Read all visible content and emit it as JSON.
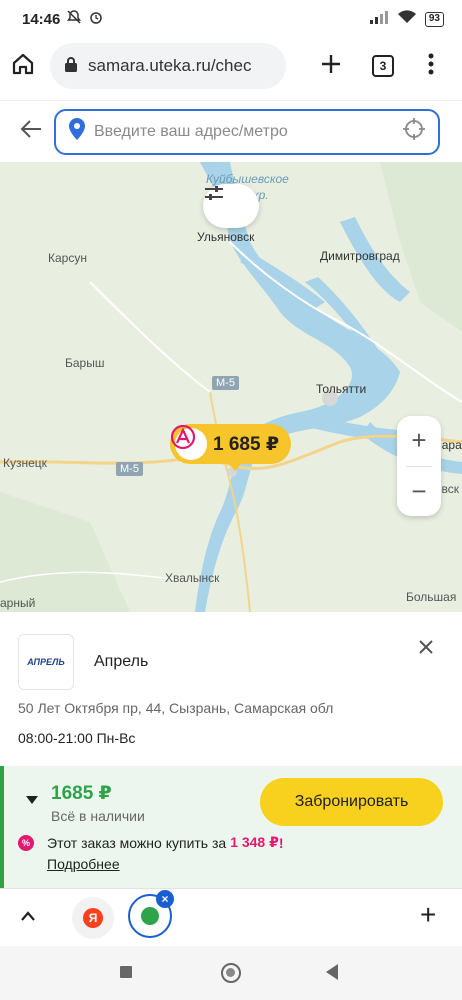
{
  "status_bar": {
    "time": "14:46",
    "battery": "93"
  },
  "browser": {
    "url": "samara.uteka.ru/chec",
    "tab_count": "3"
  },
  "search": {
    "placeholder": "Введите ваш адрес/метро"
  },
  "map": {
    "labels": {
      "reservoir": "Куйбышевское",
      "reservoir_suffix": "вдхр.",
      "ulyanovsk": "Ульяновск",
      "karsun": "Карсун",
      "dimitrovgrad": "Димитровград",
      "barysh": "Барыш",
      "togliatti": "Тольятти",
      "samara": "Самара",
      "kuznetsk": "Кузнецк",
      "chapaevsk": "Чапаевск",
      "khvalynsk": "Хвалынск",
      "bolshaya": "Большая",
      "left_edge": "арный"
    },
    "roads": [
      "М-5",
      "М-5"
    ],
    "pin_price": "1 685 ₽"
  },
  "pharmacy": {
    "logo_text": "АПРЕЛЬ",
    "name": "Апрель",
    "address": "50 Лет Октября пр, 44, Сызрань, Самарская обл",
    "hours": "08:00-21:00 Пн-Вс"
  },
  "offer": {
    "price": "1685 ₽",
    "stock": "Всё в наличии",
    "book_label": "Забронировать",
    "promo_text": "Этот заказ можно купить за",
    "promo_amount": "1 348 ₽",
    "promo_suffix": "!",
    "more_link": "Подробнее"
  },
  "bottom_panel": {
    "yandex_letter": "Я"
  },
  "colors": {
    "accent_yellow": "#f7c52b",
    "price_green": "#2ea34a",
    "promo_pink": "#e2196f",
    "link_blue": "#2f6fdb"
  }
}
